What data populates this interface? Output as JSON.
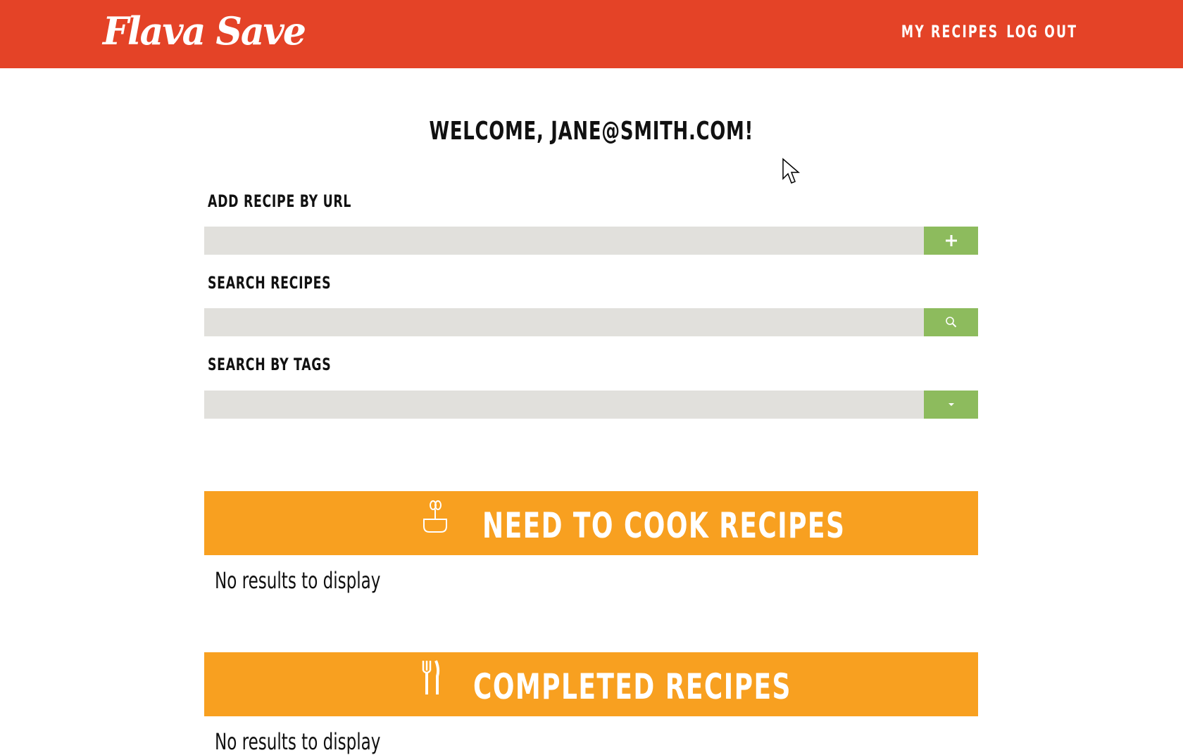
{
  "header": {
    "logo_text": "Flava Save",
    "nav": {
      "my_recipes": "MY RECIPES",
      "log_out": "LOG OUT"
    },
    "background_color": "#e44327"
  },
  "welcome_text": "WELCOME, JANE@SMITH.COM!",
  "forms": {
    "add_url": {
      "label": "ADD RECIPE BY URL",
      "value": "",
      "button_icon": "plus-icon"
    },
    "search": {
      "label": "SEARCH RECIPES",
      "value": "",
      "button_icon": "search-icon"
    },
    "tags": {
      "label": "SEARCH BY TAGS",
      "selected": "",
      "button_icon": "caret-down-icon"
    },
    "button_color": "#8dbb5d",
    "field_color": "#e1e0dc"
  },
  "sections": {
    "need_to_cook": {
      "title": "NEED TO COOK RECIPES",
      "icon": "mixing-bowl-icon",
      "empty_text": "No results to display"
    },
    "completed": {
      "title": "COMPLETED RECIPES",
      "icon": "fork-knife-icon",
      "empty_text": "No results to display"
    },
    "bar_color": "#f8a020"
  }
}
